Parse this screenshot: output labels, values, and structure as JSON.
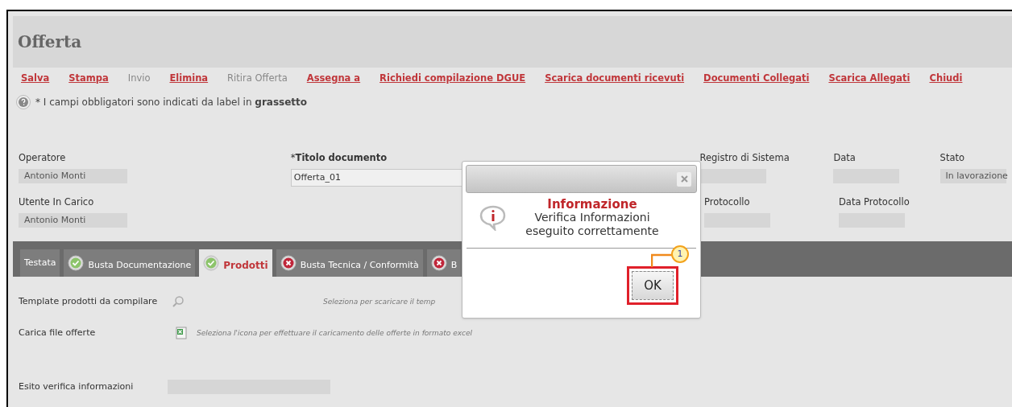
{
  "title": "Offerta",
  "toolbar": [
    {
      "label": "Salva",
      "disabled": false
    },
    {
      "label": "Stampa",
      "disabled": false
    },
    {
      "label": "Invio",
      "disabled": true
    },
    {
      "label": "Elimina",
      "disabled": false
    },
    {
      "label": "Ritira Offerta",
      "disabled": true
    },
    {
      "label": "Assegna a",
      "disabled": false
    },
    {
      "label": "Richiedi compilazione DGUE",
      "disabled": false
    },
    {
      "label": "Scarica documenti ricevuti",
      "disabled": false
    },
    {
      "label": "Documenti Collegati",
      "disabled": false
    },
    {
      "label": "Scarica Allegati",
      "disabled": false
    },
    {
      "label": "Chiudi",
      "disabled": false
    }
  ],
  "note": "* I campi obbligatori sono indicati da label in **grassetto**",
  "fields_row_1": [
    {
      "label": "Operatore",
      "value": "Antonio Monti",
      "required": false,
      "kind": "readonly"
    },
    {
      "marker": "*",
      "label": "Titolo documento",
      "value": "Offerta_01",
      "required": true,
      "kind": "input"
    },
    {
      "label": "Registro di Sistema",
      "required": false,
      "kind": "readonly"
    },
    {
      "label": "Data",
      "required": false,
      "kind": "readonly"
    },
    {
      "label": "Stato",
      "value": "In lavorazione",
      "required": false,
      "kind": "readonly"
    }
  ],
  "fields_row_2": [
    {
      "label": "Utente In Carico",
      "value": "Antonio Monti",
      "required": false,
      "kind": "readonly"
    },
    {
      "label": "Protocollo",
      "required": false,
      "kind": "readonly"
    },
    {
      "label": "Data Protocollo",
      "required": false,
      "kind": "readonly"
    }
  ],
  "tabs": [
    {
      "label": "Testata",
      "kind": "plain",
      "selected": false
    },
    {
      "label": "Busta Documentazione",
      "kind": "ok",
      "selected": false
    },
    {
      "label": "Prodotti",
      "kind": "ok",
      "selected": true
    },
    {
      "label": "Busta Tecnica / Conformità",
      "kind": "error",
      "selected": false
    },
    {
      "label": "B",
      "kind": "error",
      "selected": false
    }
  ],
  "rows": [
    {
      "label": "Template prodotti da compilare",
      "kind": "search",
      "hint": "Seleziona per scaricare il temp"
    },
    {
      "label": "Carica file offerte",
      "kind": "excel",
      "hint": "Seleziona l'icona per effettuare il caricamento delle offerte in formato excel"
    },
    {
      "label": "Esito verifica informazioni",
      "kind": "field"
    }
  ],
  "dialog": {
    "heading": "Informazione",
    "message": "Verifica Informazioni eseguito correttamente",
    "button": "OK",
    "callout": "1"
  }
}
